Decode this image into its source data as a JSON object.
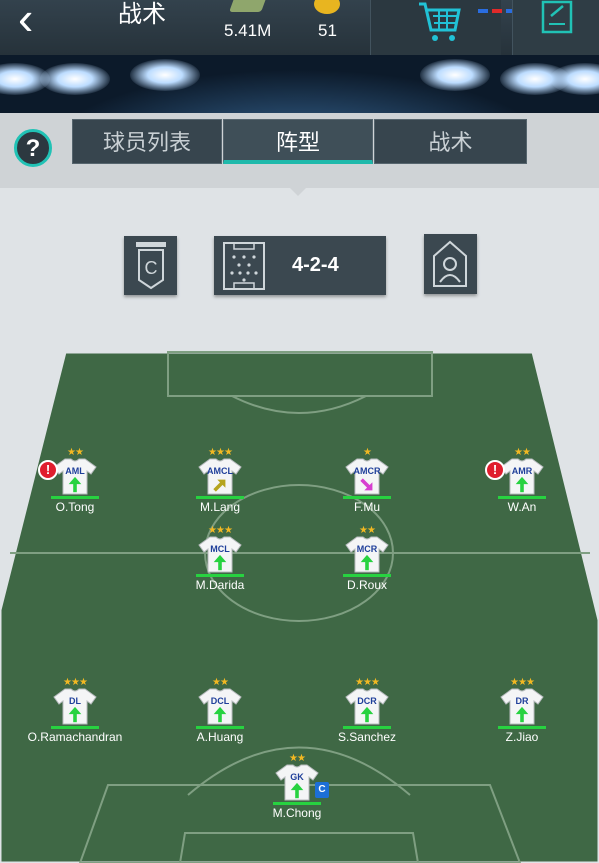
{
  "header": {
    "title": "战术",
    "cash": "5.41M",
    "coins": "51"
  },
  "tabs": [
    {
      "label": "球员列表"
    },
    {
      "label": "阵型"
    },
    {
      "label": "战术"
    }
  ],
  "help": {
    "label": "?"
  },
  "formation": {
    "value": "4-2-4"
  },
  "captain_badge": "C",
  "warning_glyph": "!",
  "players": [
    {
      "name": "O.Tong",
      "position": "AML",
      "stars": "★★",
      "arrow": "up",
      "warning": true
    },
    {
      "name": "M.Lang",
      "position": "AMCL",
      "stars": "★★★",
      "arrow": "diag-right",
      "warning": false
    },
    {
      "name": "F.Mu",
      "position": "AMCR",
      "stars": "★",
      "arrow": "diag-pink",
      "warning": false
    },
    {
      "name": "W.An",
      "position": "AMR",
      "stars": "★★",
      "arrow": "up",
      "warning": true
    },
    {
      "name": "M.Darida",
      "position": "MCL",
      "stars": "★★★",
      "arrow": "up",
      "warning": false
    },
    {
      "name": "D.Roux",
      "position": "MCR",
      "stars": "★★",
      "arrow": "up",
      "warning": false
    },
    {
      "name": "O.Ramachandran",
      "position": "DL",
      "stars": "★★★",
      "arrow": "up",
      "warning": false
    },
    {
      "name": "A.Huang",
      "position": "DCL",
      "stars": "★★",
      "arrow": "up",
      "warning": false
    },
    {
      "name": "S.Sanchez",
      "position": "DCR",
      "stars": "★★★",
      "arrow": "up",
      "warning": false
    },
    {
      "name": "Z.Jiao",
      "position": "DR",
      "stars": "★★★",
      "arrow": "up",
      "warning": false
    },
    {
      "name": "M.Chong",
      "position": "GK",
      "stars": "★★",
      "arrow": "up",
      "warning": false,
      "captain": true
    }
  ],
  "colors": {
    "accent": "#1fb9ab",
    "pitch": "#3f6845",
    "arrow_up": "#27d240",
    "arrow_diag": "#b5a41e",
    "arrow_pink": "#d73fd0",
    "warning": "#e01e2e",
    "captain": "#1c6fd6"
  }
}
